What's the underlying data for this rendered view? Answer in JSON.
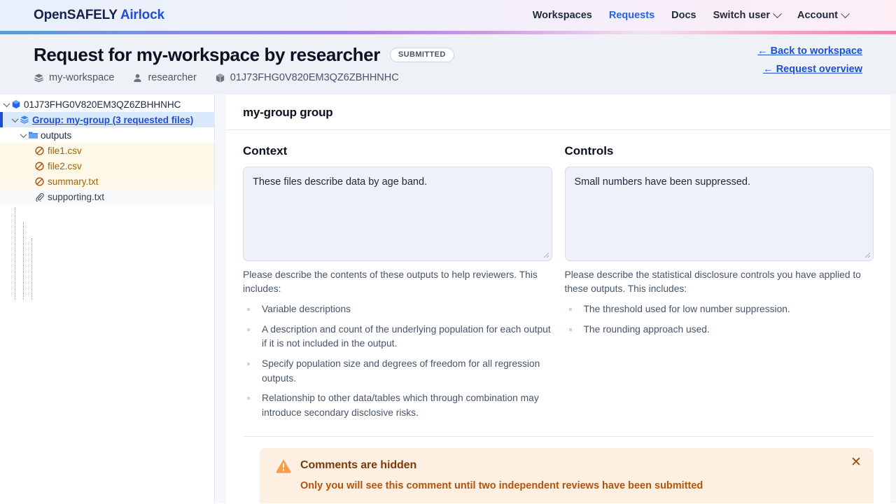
{
  "navbar": {
    "brand_primary": "OpenSAFELY",
    "brand_secondary": "Airlock",
    "links": [
      {
        "label": "Workspaces",
        "active": false,
        "caret": false
      },
      {
        "label": "Requests",
        "active": true,
        "caret": false
      },
      {
        "label": "Docs",
        "active": false,
        "caret": false
      },
      {
        "label": "Switch user",
        "active": false,
        "caret": true
      },
      {
        "label": "Account",
        "active": false,
        "caret": true
      }
    ]
  },
  "header": {
    "title": "Request for my-workspace by researcher",
    "status": "SUBMITTED",
    "meta": [
      {
        "icon": "layers-icon",
        "label": "my-workspace"
      },
      {
        "icon": "user-icon",
        "label": "researcher"
      },
      {
        "icon": "cube-icon",
        "label": "01J73FHG0V820EM3QZ6ZBHHNHC"
      }
    ],
    "links": [
      {
        "label": "← Back to workspace"
      },
      {
        "label": "← Request overview"
      }
    ]
  },
  "sidebar": {
    "root": {
      "icon": "cube-icon",
      "label": "01J73FHG0V820EM3QZ6ZBHHNHC"
    },
    "group": {
      "icon": "layers-icon",
      "label": "Group: my-group (3 requested files)"
    },
    "folder": {
      "icon": "folder-icon",
      "label": "outputs"
    },
    "files": [
      {
        "icon": "output-file-icon",
        "label": "file1.csv",
        "kind": "output"
      },
      {
        "icon": "output-file-icon",
        "label": "file2.csv",
        "kind": "output"
      },
      {
        "icon": "output-file-icon",
        "label": "summary.txt",
        "kind": "output"
      },
      {
        "icon": "paperclip-icon",
        "label": "supporting.txt",
        "kind": "supporting"
      }
    ]
  },
  "main": {
    "group_heading": "my-group group",
    "context": {
      "heading": "Context",
      "value": "These files describe data by age band.",
      "helper": "Please describe the contents of these outputs to help reviewers. This includes:",
      "bullets": [
        "Variable descriptions",
        "A description and count of the underlying population for each output if it is not included in the output.",
        "Specify population size and degrees of freedom for all regression outputs.",
        "Relationship to other data/tables which through combination may introduce secondary disclosive risks."
      ]
    },
    "controls": {
      "heading": "Controls",
      "value": "Small numbers have been suppressed.",
      "helper": "Please describe the statistical disclosure controls you have applied to these outputs. This includes:",
      "bullets": [
        "The threshold used for low number suppression.",
        "The rounding approach used."
      ]
    },
    "alert": {
      "icon": "warning-triangle-icon",
      "title": "Comments are hidden",
      "body": "Only you will see this comment until two independent reviews have been submitted",
      "close_label": "✕"
    }
  },
  "colors": {
    "accent_blue": "#1d4ed8",
    "alert_bg": "#fdf0e3",
    "alert_text": "#b45309",
    "warning_orange": "#f59e4b",
    "file_row_bg": "#fdf8e7",
    "file_text": "#a16207"
  }
}
